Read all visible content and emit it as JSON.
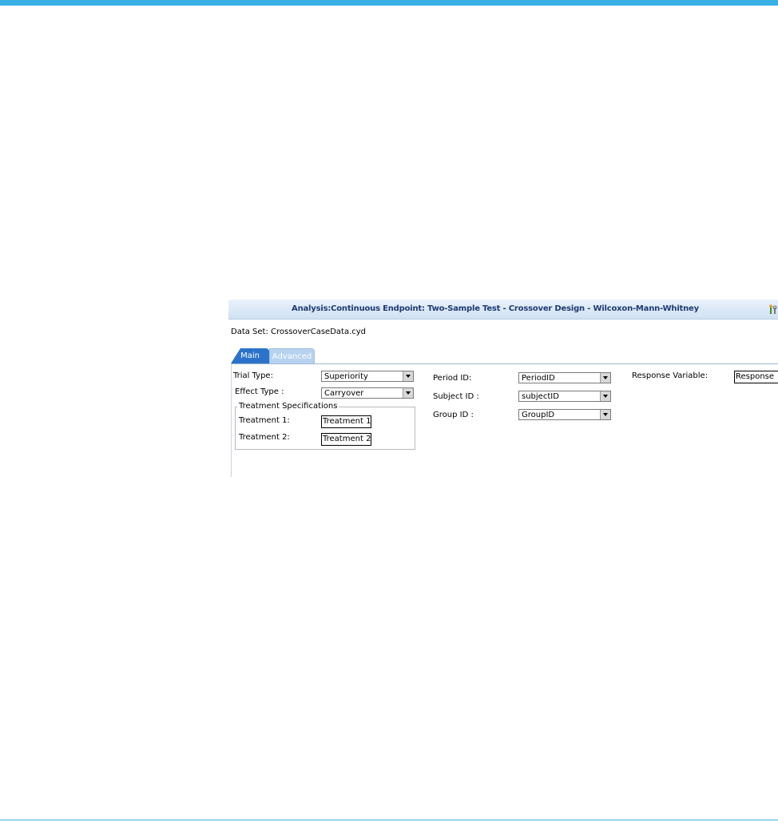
{
  "window": {
    "title": "Analysis:Continuous Endpoint: Two-Sample Test - Crossover Design - Wilcoxon-Mann-Whitney",
    "title_icon": "tools-icon"
  },
  "dataset": {
    "label": "Data Set: CrossoverCaseData.cyd"
  },
  "tabs": [
    {
      "label": "Main",
      "active": true
    },
    {
      "label": "Advanced",
      "active": false
    }
  ],
  "form": {
    "trial_type": {
      "label": "Trial Type:",
      "value": "Superiority"
    },
    "effect_type": {
      "label": "Effect Type :",
      "value": "Carryover"
    },
    "treatment_specs": {
      "legend": "Treatment Specifications",
      "treatment1": {
        "label": "Treatment 1:",
        "value": "Treatment 1"
      },
      "treatment2": {
        "label": "Treatment 2:",
        "value": "Treatment 2"
      }
    },
    "period_id": {
      "label": "Period ID:",
      "value": "PeriodID"
    },
    "subject_id": {
      "label": "Subject ID :",
      "value": "subjectID"
    },
    "group_id": {
      "label": "Group ID :",
      "value": "GroupID"
    },
    "response_variable": {
      "label": "Response Variable:",
      "value": "Response"
    }
  },
  "colors": {
    "accent_bar": "#3aafe4",
    "tab_active": "#2d72c9",
    "tab_inactive": "#b6d2ef",
    "title_text": "#1f3a72"
  }
}
